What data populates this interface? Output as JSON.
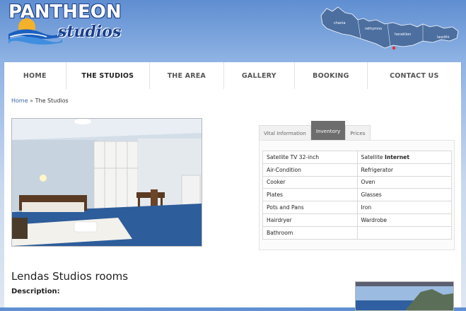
{
  "logo": {
    "line1": "PANTHEON",
    "line2": "studios"
  },
  "map": {
    "towns": [
      "chania",
      "rethymno",
      "heraklion",
      "lassithi"
    ]
  },
  "nav": {
    "items": [
      "HOME",
      "THE STUDIOS",
      "THE AREA",
      "GALLERY",
      "BOOKING",
      "CONTACT US"
    ],
    "active": "THE STUDIOS"
  },
  "breadcrumb": {
    "home": "Home",
    "separator": "»",
    "current": "The Studios"
  },
  "tabs": {
    "items": [
      "Vital Information",
      "Inventory",
      "Prices"
    ],
    "active": "Inventory"
  },
  "inventory": {
    "rows": [
      [
        "Satellite TV 32-inch",
        "Satellite "
      ],
      [
        "Air-Condition",
        "Refrigerator"
      ],
      [
        "Cooker",
        "Oven"
      ],
      [
        "Plates",
        "Glasses"
      ],
      [
        "Pots and Pans",
        "Iron"
      ],
      [
        "Hairdryer",
        "Wardrobe"
      ],
      [
        "Bathroom",
        ""
      ]
    ],
    "bold_suffix": "Internet"
  },
  "page": {
    "title": "Lendas Studios rooms",
    "description_label": "Description:"
  },
  "colors": {
    "brand_blue": "#1b3f8c",
    "tab_active": "#6d6d6d",
    "link": "#3a67a8"
  },
  "icons": {
    "logo_wave": "sun-wave-icon",
    "map": "crete-map"
  }
}
